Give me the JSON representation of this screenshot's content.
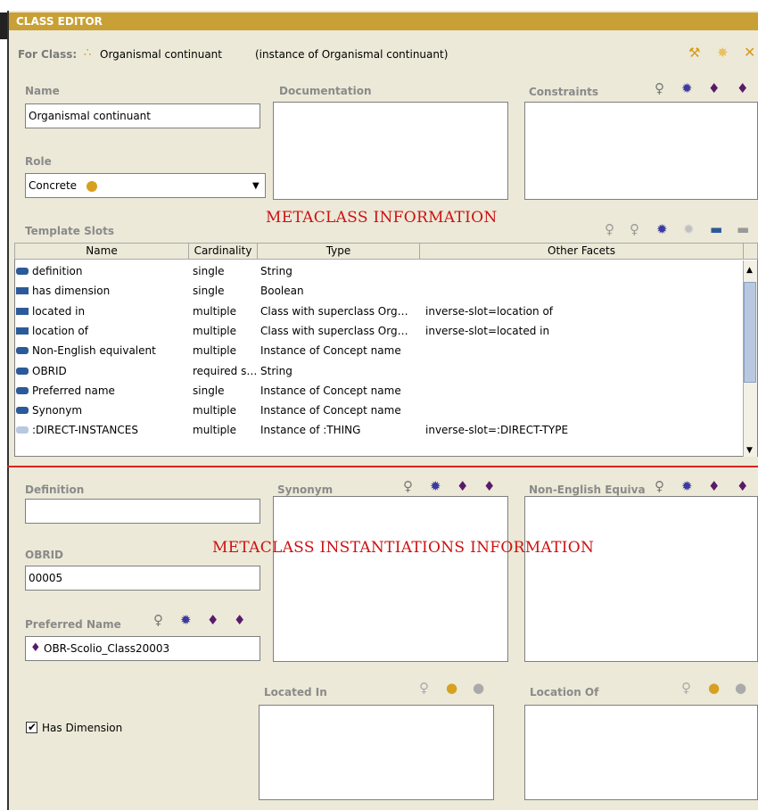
{
  "editor": {
    "title": "CLASS EDITOR",
    "for_class_label": "For Class:",
    "class_name": "Organismal continuant",
    "instance_of": "(instance of Organismal continuant)"
  },
  "fields": {
    "name_label": "Name",
    "name_value": "Organismal continuant",
    "documentation_label": "Documentation",
    "constraints_label": "Constraints",
    "role_label": "Role",
    "role_value": "Concrete"
  },
  "annotations": {
    "metaclass": "METACLASS INFORMATION",
    "instantiations": "METACLASS INSTANTIATIONS INFORMATION"
  },
  "template_slots": {
    "label": "Template Slots",
    "columns": [
      "Name",
      "Cardinality",
      "Type",
      "Other Facets"
    ],
    "rows": [
      {
        "name": "definition",
        "cardinality": "single",
        "type": "String",
        "facets": "",
        "icon": "pill"
      },
      {
        "name": "has dimension",
        "cardinality": "single",
        "type": "Boolean",
        "facets": "",
        "icon": "bar"
      },
      {
        "name": "located in",
        "cardinality": "multiple",
        "type": "Class with superclass Org…",
        "facets": "inverse-slot=location of",
        "icon": "bar"
      },
      {
        "name": "location of",
        "cardinality": "multiple",
        "type": "Class with superclass Org…",
        "facets": "inverse-slot=located in",
        "icon": "bar"
      },
      {
        "name": "Non-English equivalent",
        "cardinality": "multiple",
        "type": "Instance of Concept name",
        "facets": "",
        "icon": "pill"
      },
      {
        "name": "OBRID",
        "cardinality": "required s…",
        "type": "String",
        "facets": "",
        "icon": "pill"
      },
      {
        "name": "Preferred name",
        "cardinality": "single",
        "type": "Instance of Concept name",
        "facets": "",
        "icon": "pill"
      },
      {
        "name": "Synonym",
        "cardinality": "multiple",
        "type": "Instance of Concept name",
        "facets": "",
        "icon": "pill"
      },
      {
        "name": ":DIRECT-INSTANCES",
        "cardinality": "multiple",
        "type": "Instance of :THING",
        "facets": "inverse-slot=:DIRECT-TYPE",
        "icon": "pill-light"
      }
    ]
  },
  "instance": {
    "definition_label": "Definition",
    "definition_value": "",
    "synonym_label": "Synonym",
    "non_english_label": "Non-English Equiva",
    "obrid_label": "OBRID",
    "obrid_value": "00005",
    "preferred_name_label": "Preferred Name",
    "preferred_name_value": "OBR-Scolio_Class20003",
    "located_in_label": "Located In",
    "location_of_label": "Location Of",
    "has_dimension_label": "Has Dimension",
    "has_dimension_checked": true
  },
  "colors": {
    "title_bar": "#c8a035",
    "annotation_red": "#cc1111",
    "divider_red": "#dd2222",
    "slot_icon_blue": "#2b5a9a"
  }
}
